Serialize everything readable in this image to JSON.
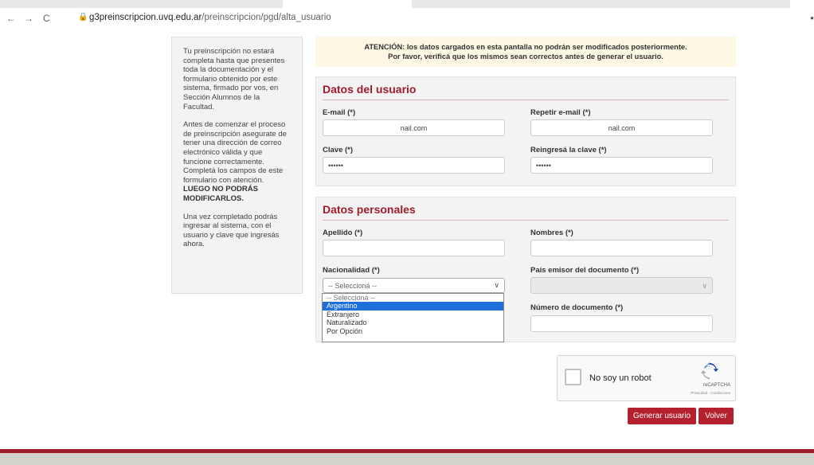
{
  "browser": {
    "back": "←",
    "forward": "→",
    "reload": "C",
    "url_domain": "g3preinscripcion.uvq.edu.ar",
    "url_path": "/preinscripcion/pgd/alta_usuario"
  },
  "sidebar": {
    "p1": "Tu preinscripción no estará completa hasta que presentes toda la documentación y el formulario obtenido por este sistema, firmado por vos, en Sección Alumnos de la Facultad.",
    "p2": "Antes de comenzar el proceso de preinscripción asegurate de tener una dirección de correo electrónico válida y que funcione correctamente. Completá los campos de este formulario con atención.",
    "p2_strong": "LUEGO NO PODRÁS MODIFICARLOS.",
    "p3": "Una vez completado podrás ingresar al sistema, con el usuario y clave que ingresás ahora."
  },
  "alert": {
    "line1": "ATENCIÓN: los datos cargados en esta pantalla no podrán ser modificados posteriormente.",
    "line2": "Por favor, verificá que los mismos sean correctos antes de generar el usuario."
  },
  "user_panel": {
    "title": "Datos del usuario",
    "email_label": "E-mail (*)",
    "email_value": "nail.com",
    "email_repeat_label": "Repetir e-mail (*)",
    "email_repeat_value": "nail.com",
    "password_label": "Clave (*)",
    "password_value": "••••••",
    "password_repeat_label": "Reingresá la clave (*)",
    "password_repeat_value": "••••••"
  },
  "personal_panel": {
    "title": "Datos personales",
    "apellido_label": "Apellido (*)",
    "nombres_label": "Nombres (*)",
    "nacionalidad_label": "Nacionalidad (*)",
    "nacionalidad_value": "-- Seleccioná --",
    "pais_label": "País emisor del documento (*)",
    "numero_label": "Número de documento (*)"
  },
  "dropdown_options": [
    "-- Seleccioná --",
    "Argentino",
    "Extranjero",
    "Naturalizado",
    "Por Opción"
  ],
  "captcha": {
    "label": "No soy un robot",
    "brand": "reCAPTCHA",
    "terms": "Privacidad - Condiciones"
  },
  "buttons": {
    "generate": "Generar usuario",
    "back": "Volver"
  },
  "colors": {
    "accent": "#a11c2b",
    "button": "#b5202e",
    "highlight": "#1e6fd9"
  }
}
